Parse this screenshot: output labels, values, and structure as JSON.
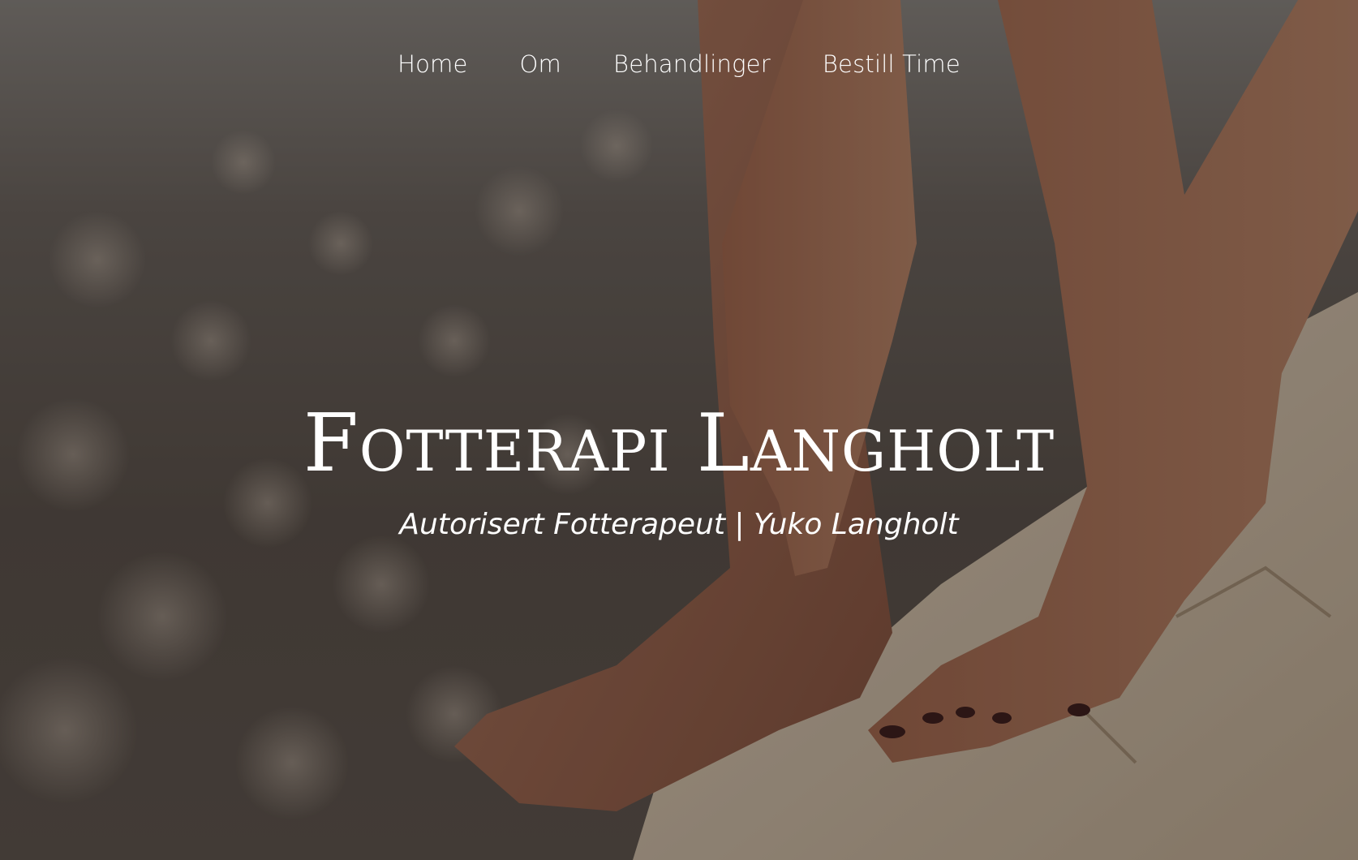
{
  "nav": {
    "items": [
      {
        "label": "Home"
      },
      {
        "label": "Om"
      },
      {
        "label": "Behandlinger"
      },
      {
        "label": "Bestill Time"
      }
    ]
  },
  "hero": {
    "title": "Fotterapi Langholt",
    "subtitle": "Autorisert Fotterapeut | Yuko Langholt",
    "background_image": "feet-on-rock-beach-photo"
  },
  "colors": {
    "text": "#ffffff",
    "overlay": "#14100e"
  }
}
